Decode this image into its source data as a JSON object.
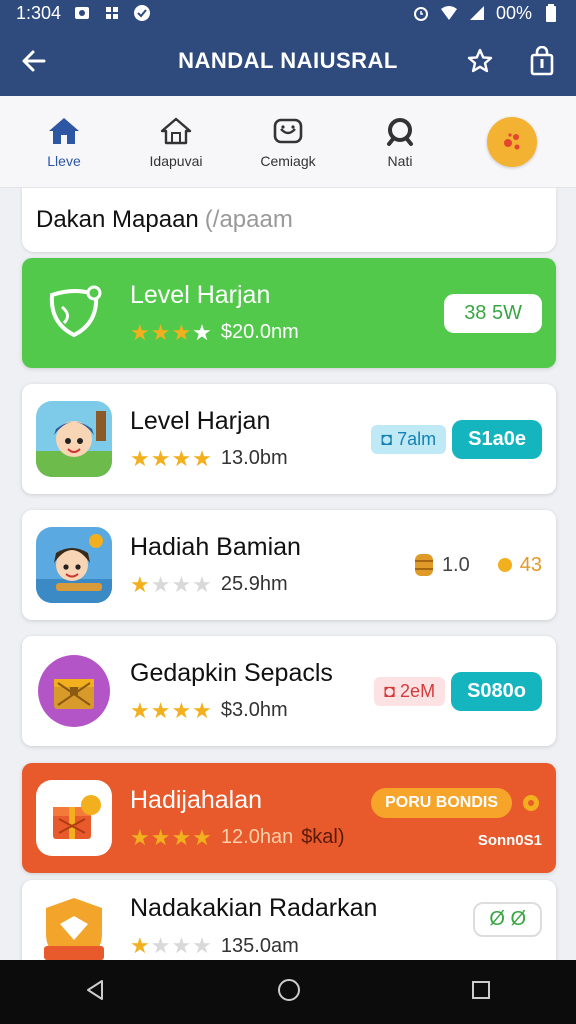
{
  "status_bar": {
    "time": "1:304",
    "battery": "00%"
  },
  "app_bar": {
    "title": "NANDAL NAIUSRAL"
  },
  "tabs": [
    {
      "label": "Lleve",
      "icon": "home-icon",
      "active": true
    },
    {
      "label": "Idapuvai",
      "icon": "house-outline-icon",
      "active": false
    },
    {
      "label": "Cemiagk",
      "icon": "camera-icon",
      "active": false
    },
    {
      "label": "Nati",
      "icon": "search-icon",
      "active": false
    }
  ],
  "search": {
    "value": "Dakan Mapaan",
    "placeholder": "(/apaam"
  },
  "items": [
    {
      "title": "Level Harjan",
      "stars": 4,
      "price": "$20.0nm",
      "action": "38 5W"
    },
    {
      "title": "Level Harjan",
      "stars": 4,
      "price": "13.0bm",
      "tag": "7alm",
      "action": "S1a0e"
    },
    {
      "title": "Hadiah Bamian",
      "stars": 1,
      "price": "25.9hm",
      "coin1": "1.0",
      "coin2": "43"
    },
    {
      "title": "Gedapkin Sepacls",
      "stars": 4,
      "price": "$3.0hm",
      "tag": "2eM",
      "action": "S080o"
    },
    {
      "title": "Hadijahalan",
      "stars": 4,
      "price": "12.0han",
      "price_extra": "$kal)",
      "pill": "PORU BONDIS",
      "sub": "Sonn0S1"
    },
    {
      "title": "Nadakakian Radarkan",
      "stars": 1,
      "price": "135.0am",
      "action": "Ø Ø"
    }
  ],
  "colors": {
    "primary": "#2f4b7e",
    "green_card": "#52c94a",
    "orange_card": "#e8592b",
    "teal": "#15b5c0",
    "star": "#f2b01e"
  }
}
